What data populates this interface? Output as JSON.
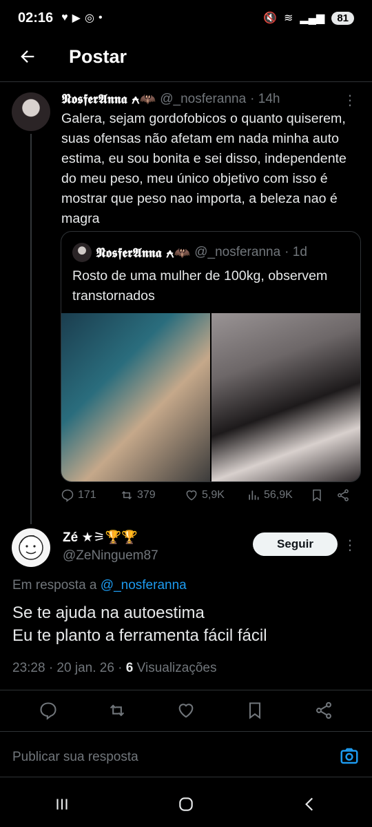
{
  "status": {
    "time": "02:16",
    "battery": "81"
  },
  "header": {
    "title": "Postar"
  },
  "tweet": {
    "name": "𝕹𝖔𝖘𝖋𝖊𝖗𝕬𝖓𝖓𝖆 ⍲🦇",
    "handle": "@_nosferanna",
    "time": "· 14h",
    "text": "Galera, sejam gordofobicos o quanto quiserem, suas ofensas não afetam em nada minha auto estima, eu sou bonita e sei disso, independente do meu peso, meu único objetivo com isso é mostrar que peso nao importa, a beleza nao é magra",
    "quote": {
      "name": "𝕹𝖔𝖘𝖋𝖊𝖗𝕬𝖓𝖓𝖆 ⍲🦇",
      "handle": "@_nosferanna",
      "time": "· 1d",
      "text": "Rosto de uma mulher de 100kg, observem transtornados"
    },
    "stats": {
      "replies": "171",
      "reposts": "379",
      "likes": "5,9K",
      "views": "56,9K"
    }
  },
  "reply": {
    "name": "Zé ★⚞🏆🏆",
    "handle": "@ZeNinguem87",
    "follow_label": "Seguir",
    "reply_to_prefix": "Em resposta a",
    "reply_to_mention": "@_nosferanna",
    "text_line1": "Se te ajuda na autoestima",
    "text_line2": "Eu te planto a ferramenta fácil fácil",
    "timestamp": "23:28 · 20 jan. 26 ·",
    "views_count": "6",
    "views_label": "Visualizações"
  },
  "compose": {
    "placeholder": "Publicar sua resposta"
  },
  "colors": {
    "background": "#000000",
    "link": "#1d9bf0",
    "muted": "#71767b"
  }
}
